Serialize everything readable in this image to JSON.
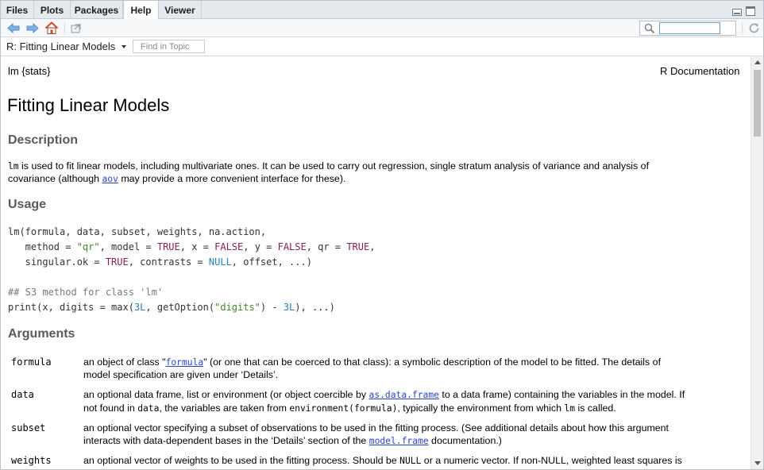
{
  "tabs": [
    {
      "label": "Files",
      "active": false
    },
    {
      "label": "Plots",
      "active": false
    },
    {
      "label": "Packages",
      "active": false
    },
    {
      "label": "Help",
      "active": true
    },
    {
      "label": "Viewer",
      "active": false
    }
  ],
  "toolbar": {
    "back_icon": "arrow-left-icon",
    "forward_icon": "arrow-right-icon",
    "home_icon": "home-icon",
    "popout_icon": "show-in-new-window-icon",
    "search_icon": "search-icon",
    "search_value": "",
    "refresh_icon": "refresh-icon",
    "accent_color": "#4d8fd1",
    "home_color": "#d24a2b"
  },
  "topic_bar": {
    "topic_label": "R: Fitting Linear Models",
    "find_placeholder": "Find in Topic"
  },
  "doc": {
    "header_left": "lm {stats}",
    "header_right": "R Documentation",
    "title": "Fitting Linear Models",
    "description_heading": "Description",
    "description": {
      "line1_code": "lm",
      "line1_rest": " is used to fit linear models, including multivariate ones. It can be used to carry out regression, single stratum analysis of variance and analysis of",
      "line2_pre": "covariance (although ",
      "line2_link": "aov",
      "line2_post": " may provide a more convenient interface for these)."
    },
    "usage_heading": "Usage",
    "usage_code": [
      "lm(formula, data, subset, weights, na.action,",
      "   method = \"qr\", model = TRUE, x = FALSE, y = FALSE, qr = TRUE,",
      "   singular.ok = TRUE, contrasts = NULL, offset, ...)",
      "",
      "## S3 method for class 'lm'",
      "print(x, digits = max(3L, getOption(\"digits\") - 3L), ...)"
    ],
    "arguments_heading": "Arguments",
    "arguments": [
      {
        "name": "formula",
        "l1_pre": "an object of class \"",
        "l1_link": "formula",
        "l1_post": "\" (or one that can be coerced to that class): a symbolic description of the model to be fitted. The details of",
        "l2": "model specification are given under ‘Details’."
      },
      {
        "name": "data",
        "l1_pre": "an optional data frame, list or environment (or object coercible by ",
        "l1_link": "as.data.frame",
        "l1_post": " to a data frame) containing the variables in the model. If",
        "l2_a": "not found in ",
        "l2_code1": "data",
        "l2_b": ", the variables are taken from ",
        "l2_code2": "environment(formula)",
        "l2_c": ", typically the environment from which ",
        "l2_code3": "lm",
        "l2_d": " is called."
      },
      {
        "name": "subset",
        "l1": "an optional vector specifying a subset of observations to be used in the fitting process. (See additional details about how this argument",
        "l2_pre": "interacts with data-dependent bases in the ‘Details’ section of the ",
        "l2_link": "model.frame",
        "l2_post": " documentation.)"
      },
      {
        "name": "weights",
        "l1_pre": "an optional vector of weights to be used in the fitting process. Should be ",
        "l1_code": "NULL",
        "l1_post": " or a numeric vector. If non-NULL, weighted least squares is"
      }
    ]
  }
}
